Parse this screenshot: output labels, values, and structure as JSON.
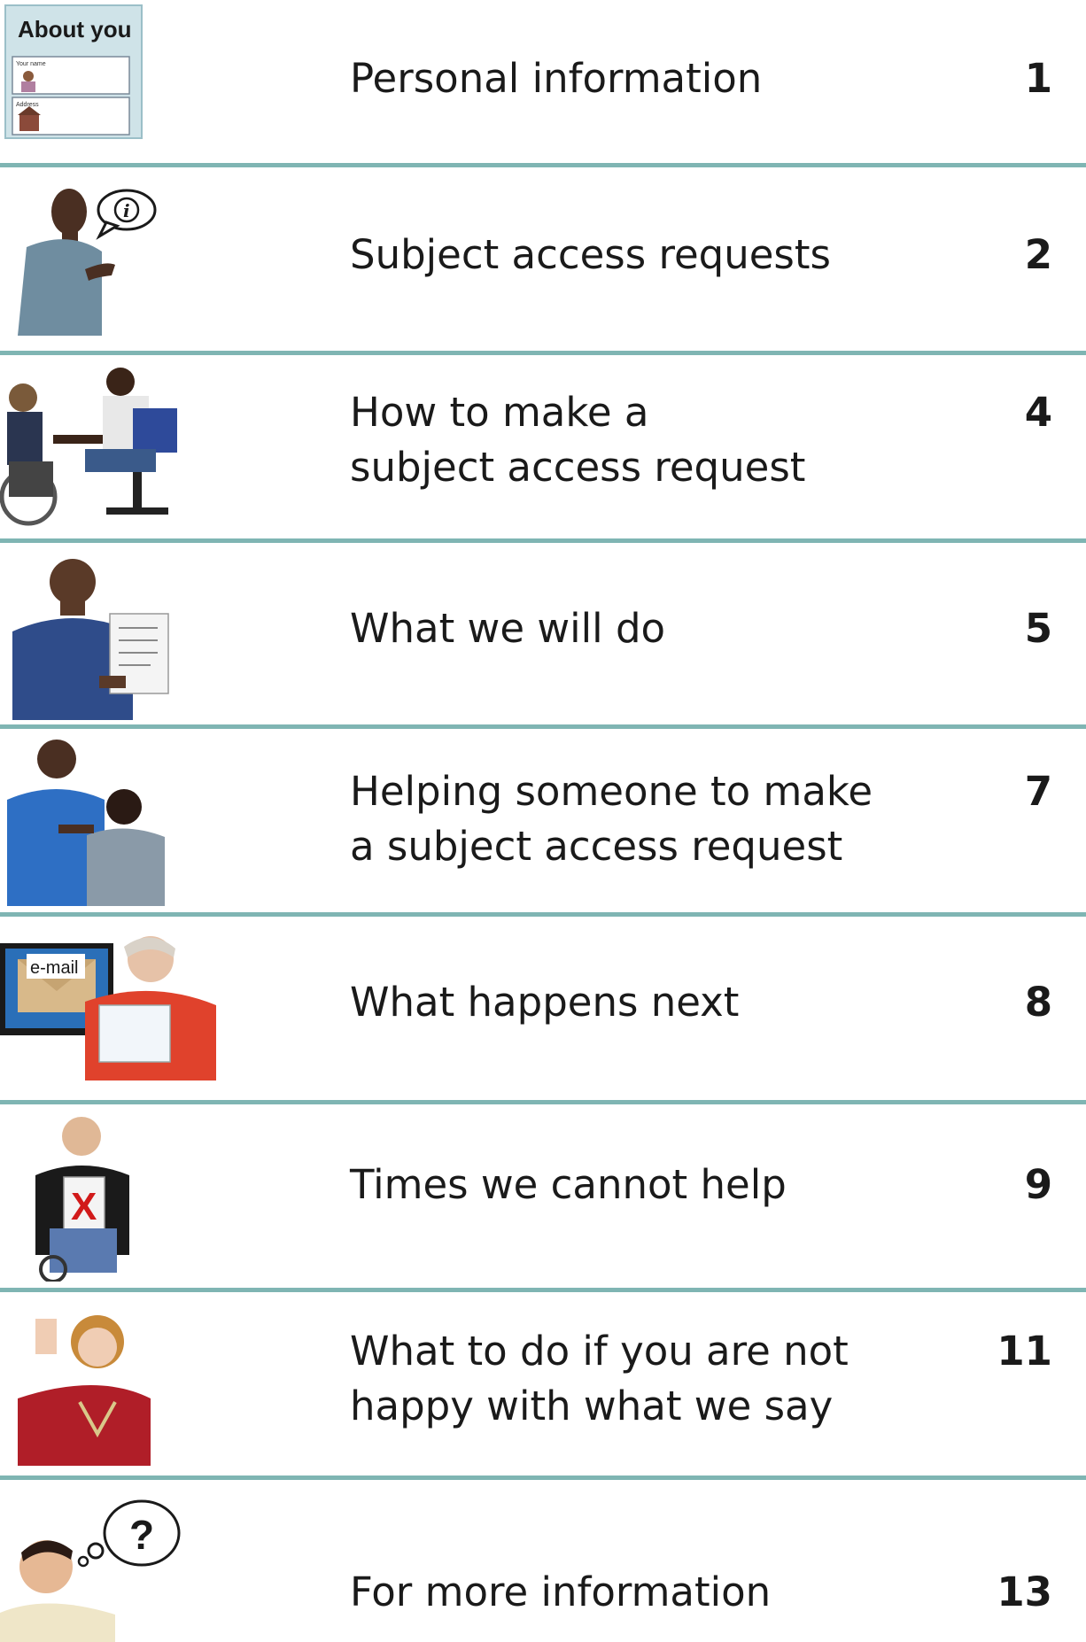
{
  "entries": [
    {
      "title": "Personal information",
      "page": "1",
      "illustration": "about-you-form-icon",
      "form": {
        "heading": "About you",
        "field1": "Your name",
        "field2": "Address"
      }
    },
    {
      "title": "Subject access requests",
      "page": "2",
      "illustration": "man-speaking-info-icon",
      "bubble": "i"
    },
    {
      "title_lines": [
        "How to make a",
        "subject access request"
      ],
      "page": "4",
      "illustration": "two-people-meeting-icon"
    },
    {
      "title": "What we will do",
      "page": "5",
      "illustration": "man-holding-document-icon"
    },
    {
      "title_lines": [
        "Helping someone to make",
        "a subject access request"
      ],
      "page": "7",
      "illustration": "helper-with-person-icon"
    },
    {
      "title": "What happens next",
      "page": "8",
      "illustration": "woman-reading-email-icon",
      "email_label": "e-mail"
    },
    {
      "title": "Times we cannot help",
      "page": "9",
      "illustration": "man-with-cross-sign-icon",
      "sign": "X"
    },
    {
      "title_lines": [
        "What to do if you are not",
        "happy with what we say"
      ],
      "page": "11",
      "illustration": "woman-thumbs-down-icon"
    },
    {
      "title": "For more information",
      "page": "13",
      "illustration": "man-thinking-question-icon",
      "bubble": "?"
    }
  ],
  "colors": {
    "divider": "#7fb5b3",
    "text": "#1a1a1a",
    "form_bg": "#cfe3e8"
  }
}
